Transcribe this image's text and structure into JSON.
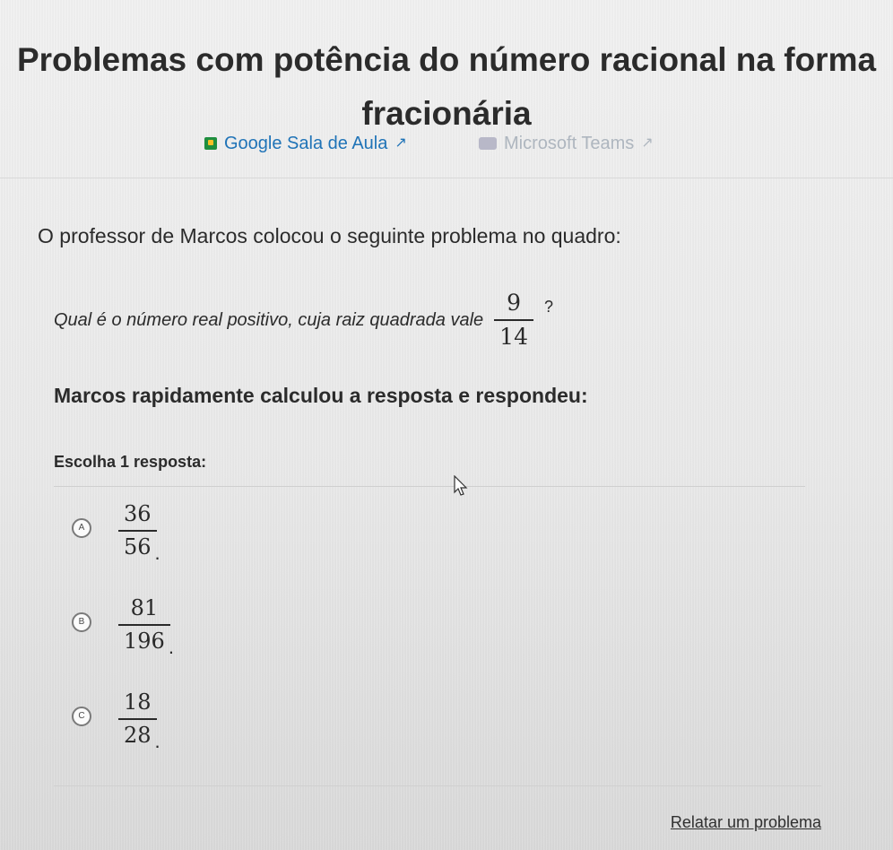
{
  "page": {
    "title": "Problemas com potência do número racional na forma fracionária"
  },
  "external_links": [
    {
      "label": "Google Sala de Aula",
      "icon": "google-classroom-icon"
    },
    {
      "label": "Microsoft Teams",
      "icon": "microsoft-teams-icon"
    }
  ],
  "content": {
    "intro": "O professor de Marcos colocou o seguinte problema no quadro:",
    "question_text": "Qual é o número real positivo, cuja raiz quadrada vale",
    "question_fraction": {
      "numerator": "9",
      "denominator": "14"
    },
    "question_mark": "?",
    "marcos": "Marcos rapidamente calculou a resposta e respondeu:",
    "choose_prompt": "Escolha 1 resposta:"
  },
  "choices": [
    {
      "letter": "A",
      "numerator": "36",
      "denominator": "56",
      "suffix": "."
    },
    {
      "letter": "B",
      "numerator": "81",
      "denominator": "196",
      "suffix": "."
    },
    {
      "letter": "C",
      "numerator": "18",
      "denominator": "28",
      "suffix": "."
    }
  ],
  "footer": {
    "report_label": "Relatar um problema"
  },
  "colors": {
    "link_blue": "#1f73b7",
    "muted_gray": "#aeb6bf",
    "text_dark": "#2b2b2b"
  }
}
